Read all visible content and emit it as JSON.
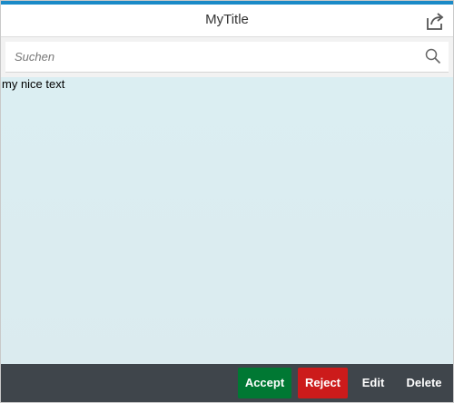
{
  "header": {
    "title": "MyTitle",
    "share_icon": "share-icon"
  },
  "search": {
    "placeholder": "Suchen",
    "value": "",
    "icon": "search-icon"
  },
  "content": {
    "text": "my nice text"
  },
  "footer": {
    "buttons": [
      {
        "label": "Accept",
        "color": "#007833"
      },
      {
        "label": "Reject",
        "color": "#cc1b1b"
      },
      {
        "label": "Edit"
      },
      {
        "label": "Delete"
      }
    ],
    "background": "#3f454b"
  },
  "colors": {
    "accent": "#1a8ac7",
    "content_background": "#dbeef2"
  }
}
